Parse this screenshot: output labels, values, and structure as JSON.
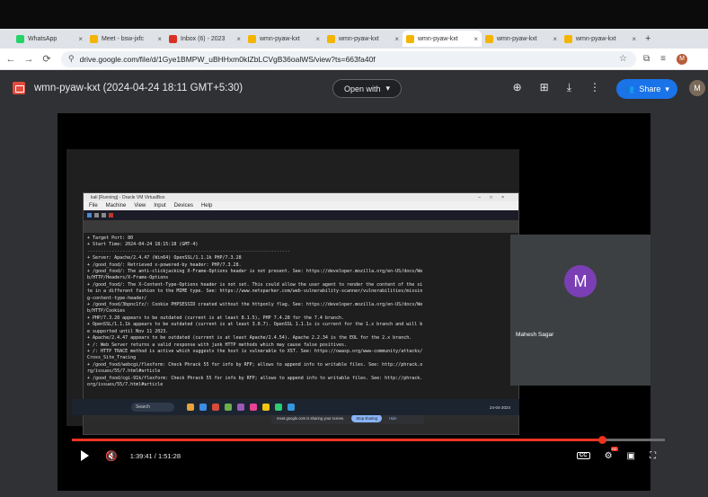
{
  "browser": {
    "tabs": [
      {
        "label": "WhatsApp",
        "icon": "whatsapp-icon",
        "color": "#25d366",
        "active": false
      },
      {
        "label": "Meet - bsw-jxfc",
        "icon": "drive-icon",
        "color": "#f4b400",
        "active": false
      },
      {
        "label": "Inbox (6) - 2023",
        "icon": "gmail-icon",
        "color": "#d93025",
        "active": false
      },
      {
        "label": "wmn-pyaw-kxt",
        "icon": "drive-icon",
        "color": "#f4b400",
        "active": false
      },
      {
        "label": "wmn-pyaw-kxt",
        "icon": "drive-icon",
        "color": "#f4b400",
        "active": false
      },
      {
        "label": "wmn-pyaw-kxt",
        "icon": "drive-icon",
        "color": "#f4b400",
        "active": true
      },
      {
        "label": "wmn-pyaw-kxt",
        "icon": "drive-icon",
        "color": "#f4b400",
        "active": false
      },
      {
        "label": "wmn-pyaw-kxt",
        "icon": "drive-icon",
        "color": "#f4b400",
        "active": false
      }
    ],
    "url": "drive.google.com/file/d/1Gye1BMPW_uBHHxm0kIZbLCVgB36oalWS/view?ts=663fa40f",
    "profile_initial": "M"
  },
  "viewer": {
    "file_title": "wmn-pyaw-kxt (2024-04-24 18:11 GMT+5:30)",
    "open_with_label": "Open with",
    "share_label": "Share",
    "avatar_initial": "M"
  },
  "meet": {
    "participant_initial": "M",
    "participant_name": "Mahesh Sagar",
    "share_notice": "meet.google.com is sharing your screen.",
    "stop_sharing": "Stop sharing",
    "hide": "Hide"
  },
  "vm": {
    "window_title": "kali [Running] - Oracle VM VirtualBox",
    "menu": [
      "File",
      "Machine",
      "View",
      "Input",
      "Devices",
      "Help"
    ],
    "terminal_lines": [
      "+ Target Port:        80",
      "+ Start Time:         2024-04-24 18:15:18 (GMT-4)",
      "---------------------------------------------------------------------------",
      "+ Server: Apache/2.4.47 (Win64) OpenSSL/1.1.1k PHP/7.3.28",
      "+ /good_food/: Retrieved x-powered-by header: PHP/7.3.28.",
      "+ /good_food/: The anti-clickjacking X-Frame-Options header is not present. See: https://developer.mozilla.org/en-US/docs/We",
      "b/HTTP/Headers/X-Frame-Options",
      "+ /good_food/: The X-Content-Type-Options header is not set. This could allow the user agent to render the content of the si",
      "te in a different fashion to the MIME type. See: https://www.netsparker.com/web-vulnerability-scanner/vulnerabilities/missin",
      "g-content-type-header/",
      "+ /good_food/3bpnc1fz/: Cookie PHPSESSID created without the httponly flag. See: https://developer.mozilla.org/en-US/docs/We",
      "b/HTTP/Cookies",
      "+ PHP/7.3.28 appears to be outdated (current is at least 8.1.5), PHP 7.4.28 for the 7.4 branch.",
      "+ OpenSSL/1.1.1k appears to be outdated (current is at least 3.0.7). OpenSSL 1.1.1s is current for the 1.x branch and will b",
      "e supported until Nov 11 2023.",
      "+ Apache/2.4.47 appears to be outdated (current is at least Apache/2.4.54). Apache 2.2.34 is the EOL for the 2.x branch.",
      "+ /: Web Server returns a valid response with junk HTTP methods which may cause false positives.",
      "+ /: HTTP TRACE method is active which suggests the host is vulnerable to XST. See: https://owasp.org/www-community/attacks/",
      "Cross_Site_Tracing",
      "+ /good_food/webcgi/flexform: Check Phrack 55 for info by RFP; allows to append info to writable files. See: http://phrack.o",
      "rg/issues/55/7.html#article",
      "+ /good_food/cgi-91k/flexform: Check Phrack 55 for info by RFP; allows to append info to writable files. See: http://phrack.",
      "org/issues/55/7.html#article"
    ]
  },
  "taskbar": {
    "search_label": "Search",
    "date": "24-04-2024",
    "app_colors": [
      "#e8a33c",
      "#3c8de8",
      "#d84a3a",
      "#6ab04c",
      "#9b59b6",
      "#e84393",
      "#f1c40f",
      "#2ecc71",
      "#3498db"
    ]
  },
  "player": {
    "time": "1:39:41 / 1:51:28",
    "progress": 0.894,
    "colors": {
      "progress": "#ee3322"
    }
  }
}
